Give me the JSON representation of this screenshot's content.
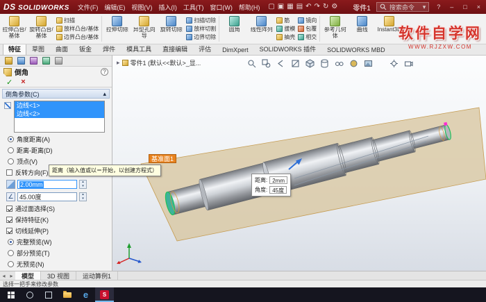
{
  "titlebar": {
    "logo_ds": "DS",
    "logo_brand": "SOLIDWORKS",
    "menus": [
      "文件(F)",
      "编辑(E)",
      "视图(V)",
      "插入(I)",
      "工具(T)",
      "窗口(W)",
      "帮助(H)"
    ],
    "doc_title": "零件1",
    "search_label": "搜索命令"
  },
  "icons": {
    "new": "▢",
    "open": "▣",
    "save": "▦",
    "print": "▤",
    "undo": "↶",
    "redo": "↷",
    "rebuild": "↻",
    "options": "⚙",
    "dropdown": "▾",
    "help": "?",
    "minimize": "–",
    "maximize": "□",
    "close": "×",
    "ok": "✓",
    "cancel": "×",
    "collapse": "▴",
    "spin_up": "▴",
    "spin_down": "▾",
    "nav_left": "◂",
    "nav_right": "▸",
    "tree_caret": "▸",
    "angle": "∠"
  },
  "ribbon": {
    "groups": [
      {
        "big": [
          "拉伸凸台/基体",
          "旋转凸台/基体"
        ],
        "small": [
          "扫描",
          "放样凸台/基体",
          "边界凸台/基体"
        ]
      },
      {
        "big": [
          "拉伸切除",
          "异型孔向导",
          "旋转切除"
        ],
        "small": [
          "扫描切除",
          "放样切割",
          "边界切除"
        ]
      },
      {
        "big": [
          "圆角",
          "线性阵列"
        ],
        "small": [
          "筋",
          "拔模",
          "抽壳"
        ],
        "small2": [
          "镜向",
          "包覆",
          "相交"
        ]
      },
      {
        "big": [
          "参考几何体",
          "曲线",
          "Instant3D"
        ]
      }
    ]
  },
  "command_tabs": [
    "特征",
    "草图",
    "曲面",
    "钣金",
    "焊件",
    "模具工具",
    "直接编辑",
    "评估",
    "DimXpert",
    "SOLIDWORKS 插件",
    "SOLIDWORKS MBD"
  ],
  "property_panel": {
    "title": "倒角",
    "params_header": "倒角参数(C)",
    "edge_items": [
      "边线<1>",
      "边线<2>"
    ],
    "type_options": [
      {
        "label": "角度距离(A)",
        "selected": true
      },
      {
        "label": "距离-距离(D)",
        "selected": false
      },
      {
        "label": "顶点(V)",
        "selected": false
      }
    ],
    "flip_option": {
      "label": "反转方向(F)",
      "checked": false
    },
    "distance_value": "2.00mm",
    "angle_value": "45.00度",
    "check_options": [
      {
        "label": "通过面选择(S)",
        "checked": true
      },
      {
        "label": "保持特征(K)",
        "checked": true
      },
      {
        "label": "切线延伸(P)",
        "checked": true
      }
    ],
    "preview_options": [
      {
        "label": "完整预览(W)",
        "selected": true
      },
      {
        "label": "部分预览(T)",
        "selected": false
      },
      {
        "label": "无预览(N)",
        "selected": false
      }
    ],
    "tooltip": "距离（输入值或以＝开始，以创建方程式）"
  },
  "viewport": {
    "tree_root": "零件1 (默认<<默认>_显...",
    "plane_label": "基准面1",
    "callout": {
      "rows": [
        {
          "label": "距离:",
          "value": "2mm"
        },
        {
          "label": "角度:",
          "value": "45度"
        }
      ]
    }
  },
  "bottom_tabs": [
    "模型",
    "3D 视图",
    "运动算例1"
  ],
  "status_bar": {
    "message": "选择一把手来修改参数"
  },
  "watermark": {
    "line1": "软件自学网",
    "line2": "WWW.RJZXW.COM"
  },
  "taskbar": {
    "edge_label": "e",
    "solidworks_label": "S"
  },
  "colors": {
    "titlebar_red": "#7d1518",
    "selection_blue": "#3094fb",
    "plane_tan": "#d9c7a0",
    "edge_green": "#21c05a",
    "vertex_magenta": "#ff2bd1",
    "watermark_red": "#d4342c"
  }
}
